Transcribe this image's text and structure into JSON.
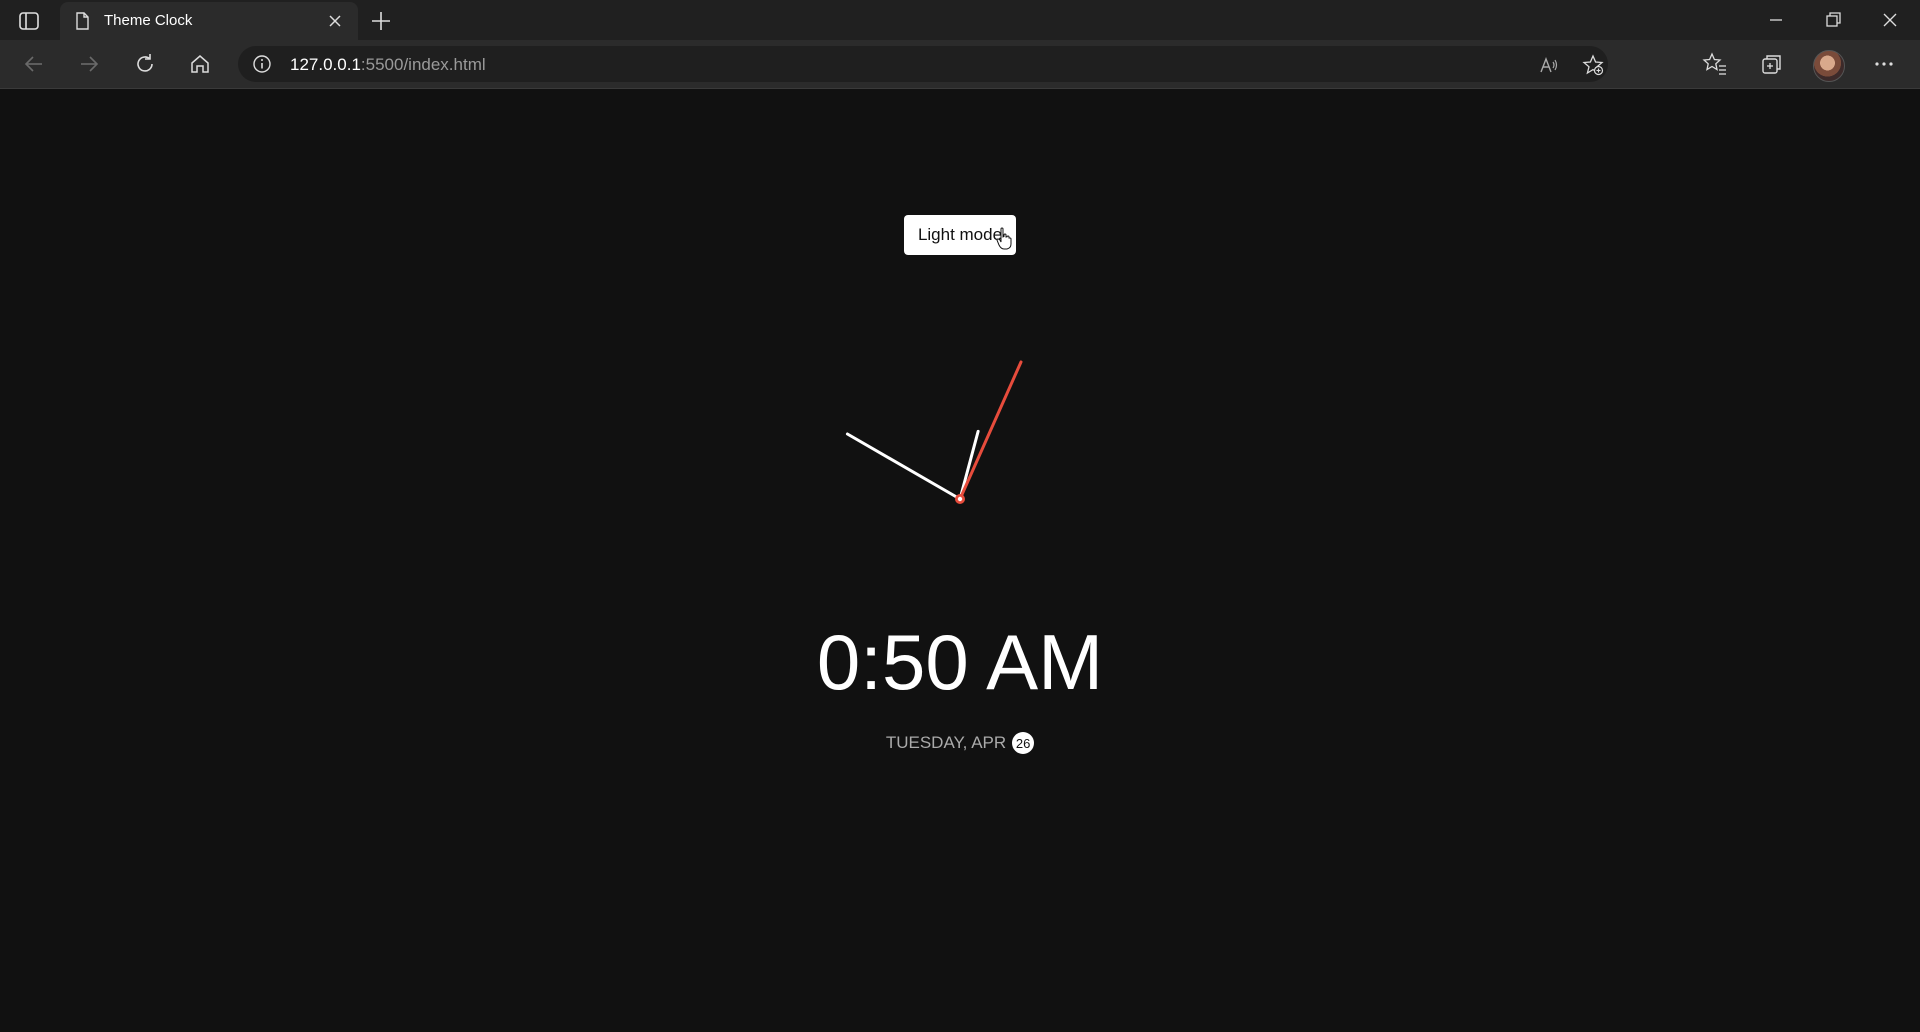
{
  "browser": {
    "tab_title": "Theme Clock",
    "url_host": "127.0.0.1",
    "url_rest": ":5500/index.html"
  },
  "icons": {
    "sidebar": "tab-sidebar-icon",
    "page": "page-icon",
    "close": "close-icon",
    "new_tab": "plus-icon",
    "back": "arrow-left-icon",
    "forward": "arrow-right-icon",
    "refresh": "refresh-icon",
    "home": "home-icon",
    "info": "info-icon",
    "read_aloud": "read-aloud-icon",
    "add_favorite": "star-add-icon",
    "favorites": "favorites-icon",
    "collections": "collections-icon",
    "more": "more-icon"
  },
  "page": {
    "toggle_label": "Light mode",
    "time": "0:50 AM",
    "date_text": "TUESDAY, APR",
    "date_day": "26",
    "clock": {
      "hours": 0,
      "minutes": 50,
      "seconds": 4
    }
  },
  "colors": {
    "background": "#111111",
    "hand": "#ffffff",
    "second_hand": "#e74c3c"
  }
}
